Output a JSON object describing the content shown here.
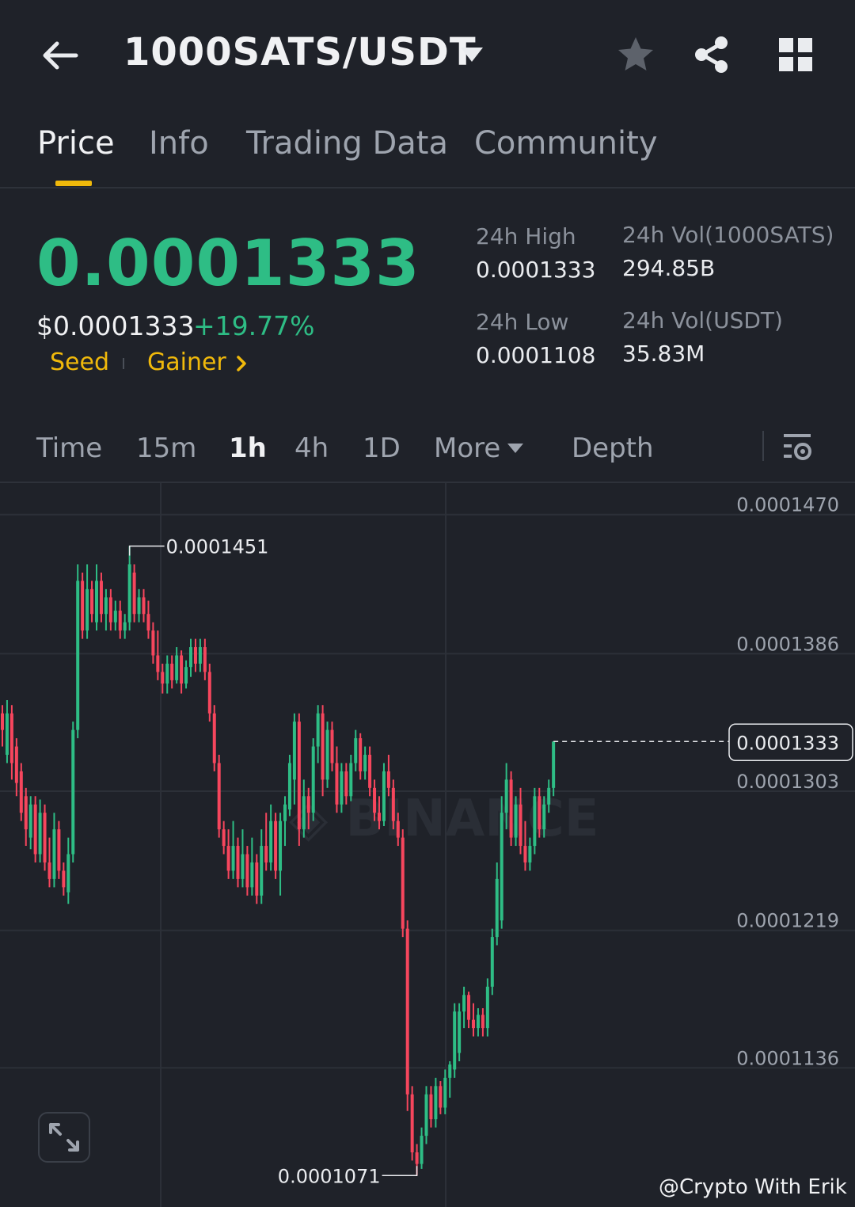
{
  "header": {
    "pair": "1000SATS/USDT",
    "icons": [
      "back-arrow-icon",
      "caret-down-icon",
      "star-icon",
      "share-icon",
      "grid-icon"
    ]
  },
  "tabs": [
    {
      "label": "Price",
      "active": true
    },
    {
      "label": "Info",
      "active": false
    },
    {
      "label": "Trading Data",
      "active": false
    },
    {
      "label": "Community",
      "active": false
    }
  ],
  "ticker": {
    "last_price": "0.0001333",
    "usd_price": "$0.0001333",
    "change": "+19.77%",
    "tags": [
      "Seed",
      "Gainer"
    ]
  },
  "stats": {
    "high_label": "24h High",
    "high_value": "0.0001333",
    "low_label": "24h Low",
    "low_value": "0.0001108",
    "vol_base_label": "24h Vol(1000SATS)",
    "vol_base_value": "294.85B",
    "vol_quote_label": "24h Vol(USDT)",
    "vol_quote_value": "35.83M"
  },
  "intervals": [
    {
      "label": "Time",
      "active": false
    },
    {
      "label": "15m",
      "active": false
    },
    {
      "label": "1h",
      "active": true
    },
    {
      "label": "4h",
      "active": false
    },
    {
      "label": "1D",
      "active": false
    },
    {
      "label": "More",
      "active": false
    },
    {
      "label": "Depth",
      "active": false
    }
  ],
  "colors": {
    "up": "#2ebd85",
    "down": "#f6465d",
    "accent": "#f0b90b",
    "background": "#1f2229"
  },
  "watermark": "@Crypto With Erik",
  "chart_data": {
    "type": "candlestick",
    "y_ticks": [
      "0.0001470",
      "0.0001386",
      "0.0001303",
      "0.0001219",
      "0.0001136"
    ],
    "ylim": [
      0.0001052,
      0.0001489
    ],
    "last_price_label": "0.0001333",
    "high_annotation": "0.0001451",
    "low_annotation": "0.0001071",
    "candles": [
      {
        "o": 0.000135,
        "h": 0.0001355,
        "l": 0.000133,
        "c": 0.000134
      },
      {
        "o": 0.0001325,
        "h": 0.0001358,
        "l": 0.000132,
        "c": 0.000135
      },
      {
        "o": 0.000135,
        "h": 0.0001355,
        "l": 0.000131,
        "c": 0.000132
      },
      {
        "o": 0.000133,
        "h": 0.0001335,
        "l": 0.00013,
        "c": 0.0001308
      },
      {
        "o": 0.0001315,
        "h": 0.000132,
        "l": 0.0001285,
        "c": 0.000129
      },
      {
        "o": 0.00013,
        "h": 0.0001305,
        "l": 0.000127,
        "c": 0.000128
      },
      {
        "o": 0.0001275,
        "h": 0.00013,
        "l": 0.0001268,
        "c": 0.0001295
      },
      {
        "o": 0.0001295,
        "h": 0.00013,
        "l": 0.000126,
        "c": 0.0001265
      },
      {
        "o": 0.0001265,
        "h": 0.0001298,
        "l": 0.000126,
        "c": 0.000129
      },
      {
        "o": 0.000129,
        "h": 0.0001295,
        "l": 0.0001255,
        "c": 0.000126
      },
      {
        "o": 0.000126,
        "h": 0.0001275,
        "l": 0.0001245,
        "c": 0.000125
      },
      {
        "o": 0.000125,
        "h": 0.000129,
        "l": 0.0001245,
        "c": 0.000128
      },
      {
        "o": 0.000128,
        "h": 0.0001285,
        "l": 0.000125,
        "c": 0.0001255
      },
      {
        "o": 0.0001255,
        "h": 0.000126,
        "l": 0.000124,
        "c": 0.0001245
      },
      {
        "o": 0.0001242,
        "h": 0.0001275,
        "l": 0.0001235,
        "c": 0.0001265
      },
      {
        "o": 0.0001265,
        "h": 0.0001345,
        "l": 0.000126,
        "c": 0.000134
      },
      {
        "o": 0.000134,
        "h": 0.000144,
        "l": 0.0001335,
        "c": 0.000143
      },
      {
        "o": 0.000143,
        "h": 0.0001435,
        "l": 0.0001395,
        "c": 0.00014
      },
      {
        "o": 0.00014,
        "h": 0.000144,
        "l": 0.0001395,
        "c": 0.0001425
      },
      {
        "o": 0.0001425,
        "h": 0.000143,
        "l": 0.0001405,
        "c": 0.000141
      },
      {
        "o": 0.0001405,
        "h": 0.000144,
        "l": 0.00014,
        "c": 0.000143
      },
      {
        "o": 0.000143,
        "h": 0.0001435,
        "l": 0.0001405,
        "c": 0.000141
      },
      {
        "o": 0.000141,
        "h": 0.0001425,
        "l": 0.00014,
        "c": 0.000142
      },
      {
        "o": 0.000142,
        "h": 0.0001425,
        "l": 0.00014,
        "c": 0.0001405
      },
      {
        "o": 0.0001405,
        "h": 0.0001418,
        "l": 0.00014,
        "c": 0.0001412
      },
      {
        "o": 0.0001412,
        "h": 0.0001418,
        "l": 0.0001395,
        "c": 0.00014
      },
      {
        "o": 0.00014,
        "h": 0.000141,
        "l": 0.0001395,
        "c": 0.0001405
      },
      {
        "o": 0.0001405,
        "h": 0.0001451,
        "l": 0.00014,
        "c": 0.000144
      },
      {
        "o": 0.0001435,
        "h": 0.000144,
        "l": 0.0001405,
        "c": 0.000141
      },
      {
        "o": 0.000141,
        "h": 0.0001425,
        "l": 0.0001405,
        "c": 0.000142
      },
      {
        "o": 0.000142,
        "h": 0.0001425,
        "l": 0.0001405,
        "c": 0.000141
      },
      {
        "o": 0.000141,
        "h": 0.0001418,
        "l": 0.0001395,
        "c": 0.00014
      },
      {
        "o": 0.00014,
        "h": 0.0001405,
        "l": 0.000138,
        "c": 0.0001385
      },
      {
        "o": 0.0001385,
        "h": 0.00014,
        "l": 0.000137,
        "c": 0.0001375
      },
      {
        "o": 0.0001375,
        "h": 0.000138,
        "l": 0.0001362,
        "c": 0.0001368
      },
      {
        "o": 0.0001368,
        "h": 0.0001385,
        "l": 0.0001362,
        "c": 0.000138
      },
      {
        "o": 0.000138,
        "h": 0.0001385,
        "l": 0.0001365,
        "c": 0.000137
      },
      {
        "o": 0.000137,
        "h": 0.000139,
        "l": 0.0001368,
        "c": 0.0001385
      },
      {
        "o": 0.0001385,
        "h": 0.0001388,
        "l": 0.0001362,
        "c": 0.0001368
      },
      {
        "o": 0.0001368,
        "h": 0.0001382,
        "l": 0.0001365,
        "c": 0.0001378
      },
      {
        "o": 0.0001378,
        "h": 0.0001395,
        "l": 0.0001372,
        "c": 0.000139
      },
      {
        "o": 0.000139,
        "h": 0.0001395,
        "l": 0.0001375,
        "c": 0.000138
      },
      {
        "o": 0.000138,
        "h": 0.0001395,
        "l": 0.0001375,
        "c": 0.000139
      },
      {
        "o": 0.000139,
        "h": 0.0001395,
        "l": 0.000137,
        "c": 0.0001375
      },
      {
        "o": 0.0001375,
        "h": 0.000138,
        "l": 0.0001345,
        "c": 0.000135
      },
      {
        "o": 0.000135,
        "h": 0.0001355,
        "l": 0.0001315,
        "c": 0.000132
      },
      {
        "o": 0.000132,
        "h": 0.0001325,
        "l": 0.0001275,
        "c": 0.000128
      },
      {
        "o": 0.000128,
        "h": 0.0001285,
        "l": 0.0001265,
        "c": 0.000127
      },
      {
        "o": 0.000127,
        "h": 0.000128,
        "l": 0.000125,
        "c": 0.0001255
      },
      {
        "o": 0.0001255,
        "h": 0.0001285,
        "l": 0.000125,
        "c": 0.000127
      },
      {
        "o": 0.000127,
        "h": 0.0001275,
        "l": 0.0001245,
        "c": 0.000125
      },
      {
        "o": 0.000125,
        "h": 0.000128,
        "l": 0.0001245,
        "c": 0.0001265
      },
      {
        "o": 0.0001265,
        "h": 0.000127,
        "l": 0.000124,
        "c": 0.0001245
      },
      {
        "o": 0.0001245,
        "h": 0.0001275,
        "l": 0.000124,
        "c": 0.000126
      },
      {
        "o": 0.000126,
        "h": 0.0001265,
        "l": 0.0001235,
        "c": 0.000124
      },
      {
        "o": 0.000124,
        "h": 0.000128,
        "l": 0.0001235,
        "c": 0.000127
      },
      {
        "o": 0.000127,
        "h": 0.000129,
        "l": 0.0001255,
        "c": 0.000126
      },
      {
        "o": 0.000126,
        "h": 0.0001295,
        "l": 0.0001255,
        "c": 0.0001285
      },
      {
        "o": 0.0001285,
        "h": 0.000129,
        "l": 0.000125,
        "c": 0.0001255
      },
      {
        "o": 0.0001255,
        "h": 0.000129,
        "l": 0.000124,
        "c": 0.0001285
      },
      {
        "o": 0.0001285,
        "h": 0.00013,
        "l": 0.000127,
        "c": 0.0001295
      },
      {
        "o": 0.0001292,
        "h": 0.0001325,
        "l": 0.0001288,
        "c": 0.000132
      },
      {
        "o": 0.000131,
        "h": 0.000135,
        "l": 0.0001295,
        "c": 0.0001345
      },
      {
        "o": 0.0001345,
        "h": 0.000135,
        "l": 0.000127,
        "c": 0.000128
      },
      {
        "o": 0.000128,
        "h": 0.000131,
        "l": 0.0001275,
        "c": 0.00013
      },
      {
        "o": 0.00013,
        "h": 0.0001305,
        "l": 0.000128,
        "c": 0.000129
      },
      {
        "o": 0.000129,
        "h": 0.0001335,
        "l": 0.0001285,
        "c": 0.000133
      },
      {
        "o": 0.000133,
        "h": 0.0001355,
        "l": 0.000132,
        "c": 0.000135
      },
      {
        "o": 0.000135,
        "h": 0.0001355,
        "l": 0.00013,
        "c": 0.000131
      },
      {
        "o": 0.000131,
        "h": 0.0001345,
        "l": 0.0001305,
        "c": 0.000134
      },
      {
        "o": 0.000134,
        "h": 0.0001345,
        "l": 0.0001315,
        "c": 0.000132
      },
      {
        "o": 0.000132,
        "h": 0.000133,
        "l": 0.000129,
        "c": 0.0001295
      },
      {
        "o": 0.0001295,
        "h": 0.000132,
        "l": 0.000129,
        "c": 0.0001315
      },
      {
        "o": 0.0001315,
        "h": 0.000132,
        "l": 0.0001295,
        "c": 0.00013
      },
      {
        "o": 0.00013,
        "h": 0.0001325,
        "l": 0.0001297,
        "c": 0.000132
      },
      {
        "o": 0.000132,
        "h": 0.000134,
        "l": 0.0001315,
        "c": 0.0001335
      },
      {
        "o": 0.0001335,
        "h": 0.0001338,
        "l": 0.000131,
        "c": 0.0001315
      },
      {
        "o": 0.0001315,
        "h": 0.000133,
        "l": 0.000131,
        "c": 0.0001325
      },
      {
        "o": 0.0001325,
        "h": 0.000133,
        "l": 0.00013,
        "c": 0.0001305
      },
      {
        "o": 0.0001305,
        "h": 0.000131,
        "l": 0.0001285,
        "c": 0.000129
      },
      {
        "o": 0.000129,
        "h": 0.00013,
        "l": 0.000128,
        "c": 0.0001285
      },
      {
        "o": 0.0001285,
        "h": 0.000132,
        "l": 0.0001282,
        "c": 0.0001315
      },
      {
        "o": 0.0001315,
        "h": 0.0001325,
        "l": 0.00013,
        "c": 0.0001305
      },
      {
        "o": 0.0001305,
        "h": 0.000131,
        "l": 0.000128,
        "c": 0.0001285
      },
      {
        "o": 0.0001285,
        "h": 0.000129,
        "l": 0.000127,
        "c": 0.0001275
      },
      {
        "o": 0.0001275,
        "h": 0.000128,
        "l": 0.0001215,
        "c": 0.000122
      },
      {
        "o": 0.000122,
        "h": 0.0001225,
        "l": 0.000111,
        "c": 0.000112
      },
      {
        "o": 0.000112,
        "h": 0.0001125,
        "l": 0.000108,
        "c": 0.0001085
      },
      {
        "o": 0.0001085,
        "h": 0.000109,
        "l": 0.0001071,
        "c": 0.0001078
      },
      {
        "o": 0.0001078,
        "h": 0.00011,
        "l": 0.0001075,
        "c": 0.0001095
      },
      {
        "o": 0.0001095,
        "h": 0.0001125,
        "l": 0.000109,
        "c": 0.000112
      },
      {
        "o": 0.000112,
        "h": 0.0001125,
        "l": 0.00011,
        "c": 0.0001105
      },
      {
        "o": 0.0001105,
        "h": 0.000113,
        "l": 0.00011,
        "c": 0.0001125
      },
      {
        "o": 0.0001125,
        "h": 0.0001128,
        "l": 0.0001108,
        "c": 0.0001112
      },
      {
        "o": 0.0001112,
        "h": 0.0001135,
        "l": 0.0001108,
        "c": 0.000113
      },
      {
        "o": 0.000113,
        "h": 0.000114,
        "l": 0.0001118,
        "c": 0.0001138
      },
      {
        "o": 0.0001135,
        "h": 0.0001175,
        "l": 0.000113,
        "c": 0.000117
      },
      {
        "o": 0.0001145,
        "h": 0.0001175,
        "l": 0.000114,
        "c": 0.000117
      },
      {
        "o": 0.000117,
        "h": 0.0001185,
        "l": 0.000116,
        "c": 0.000118
      },
      {
        "o": 0.000118,
        "h": 0.0001182,
        "l": 0.000116,
        "c": 0.0001165
      },
      {
        "o": 0.0001165,
        "h": 0.0001175,
        "l": 0.0001155,
        "c": 0.000116
      },
      {
        "o": 0.000116,
        "h": 0.0001172,
        "l": 0.0001155,
        "c": 0.0001168
      },
      {
        "o": 0.0001168,
        "h": 0.0001172,
        "l": 0.0001155,
        "c": 0.000116
      },
      {
        "o": 0.000116,
        "h": 0.000119,
        "l": 0.0001155,
        "c": 0.0001185
      },
      {
        "o": 0.0001185,
        "h": 0.000122,
        "l": 0.000118,
        "c": 0.0001215
      },
      {
        "o": 0.0001215,
        "h": 0.000126,
        "l": 0.000121,
        "c": 0.000125
      },
      {
        "o": 0.0001225,
        "h": 0.00013,
        "l": 0.000122,
        "c": 0.000129
      },
      {
        "o": 0.000129,
        "h": 0.000132,
        "l": 0.000128,
        "c": 0.000131
      },
      {
        "o": 0.000131,
        "h": 0.0001315,
        "l": 0.000127,
        "c": 0.0001275
      },
      {
        "o": 0.0001275,
        "h": 0.00013,
        "l": 0.000127,
        "c": 0.0001295
      },
      {
        "o": 0.0001295,
        "h": 0.0001305,
        "l": 0.0001265,
        "c": 0.000127
      },
      {
        "o": 0.000127,
        "h": 0.0001285,
        "l": 0.0001255,
        "c": 0.000126
      },
      {
        "o": 0.000126,
        "h": 0.0001275,
        "l": 0.0001255,
        "c": 0.000127
      },
      {
        "o": 0.000127,
        "h": 0.0001305,
        "l": 0.0001265,
        "c": 0.00013
      },
      {
        "o": 0.00013,
        "h": 0.0001305,
        "l": 0.0001275,
        "c": 0.000128
      },
      {
        "o": 0.000128,
        "h": 0.00013,
        "l": 0.0001275,
        "c": 0.0001295
      },
      {
        "o": 0.0001295,
        "h": 0.000131,
        "l": 0.000129,
        "c": 0.0001305
      },
      {
        "o": 0.0001305,
        "h": 0.0001333,
        "l": 0.00013,
        "c": 0.0001333
      }
    ]
  }
}
